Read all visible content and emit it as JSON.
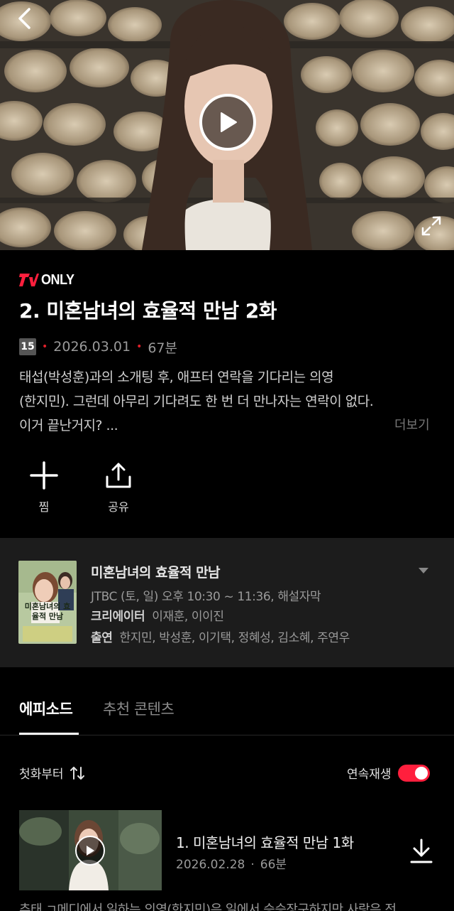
{
  "player": {
    "back_icon": "back-arrow-icon",
    "play_icon": "play-icon",
    "fullscreen_icon": "expand-icon"
  },
  "episode": {
    "brand_mark": "TV",
    "only_label": "ONLY",
    "title": "2. 미혼남녀의 효율적 만남 2화",
    "age_rating": "15",
    "date": "2026.03.01",
    "duration": "67분",
    "description_lines": [
      "태섭(박성훈)과의 소개팅 후, 애프터 연락을 기다리는 의영",
      "(한지민). 그런데 아무리 기다려도 한 번 더 만나자는 연락이 없다.",
      "이거 끝난거지? ..."
    ],
    "more_label": "더보기"
  },
  "actions": {
    "wishlist_label": "찜",
    "share_label": "공유"
  },
  "program": {
    "title": "미혼남녀의 효율적 만남",
    "broadcast": "JTBC (토, 일) 오후 10:30 ~ 11:36, 해설자막",
    "creator_label": "크리에이터",
    "creators": "이재훈, 이이진",
    "cast_label": "출연",
    "cast": "한지민, 박성훈, 이기택, 정혜성, 김소혜, 주연우",
    "poster_text": "미혼남녀의 효율적 만남"
  },
  "tabs": [
    {
      "label": "에피소드",
      "active": true
    },
    {
      "label": "추천 콘텐츠",
      "active": false
    }
  ],
  "list_controls": {
    "sort_label": "첫화부터",
    "autoplay_label": "연속재생",
    "autoplay_on": true
  },
  "episodes": [
    {
      "title": "1. 미혼남녀의 효율적 만남 1화",
      "date": "2026.02.28",
      "separator": "·",
      "duration": "66분",
      "description_partial": "추태 ㄱ메디에서 일하는 의영(한지민)은 일에서 승승장구하지만 사랑은 전"
    }
  ],
  "colors": {
    "accent_red": "#ff1f3d",
    "background": "#000000",
    "card_background": "#1c1c1c"
  }
}
